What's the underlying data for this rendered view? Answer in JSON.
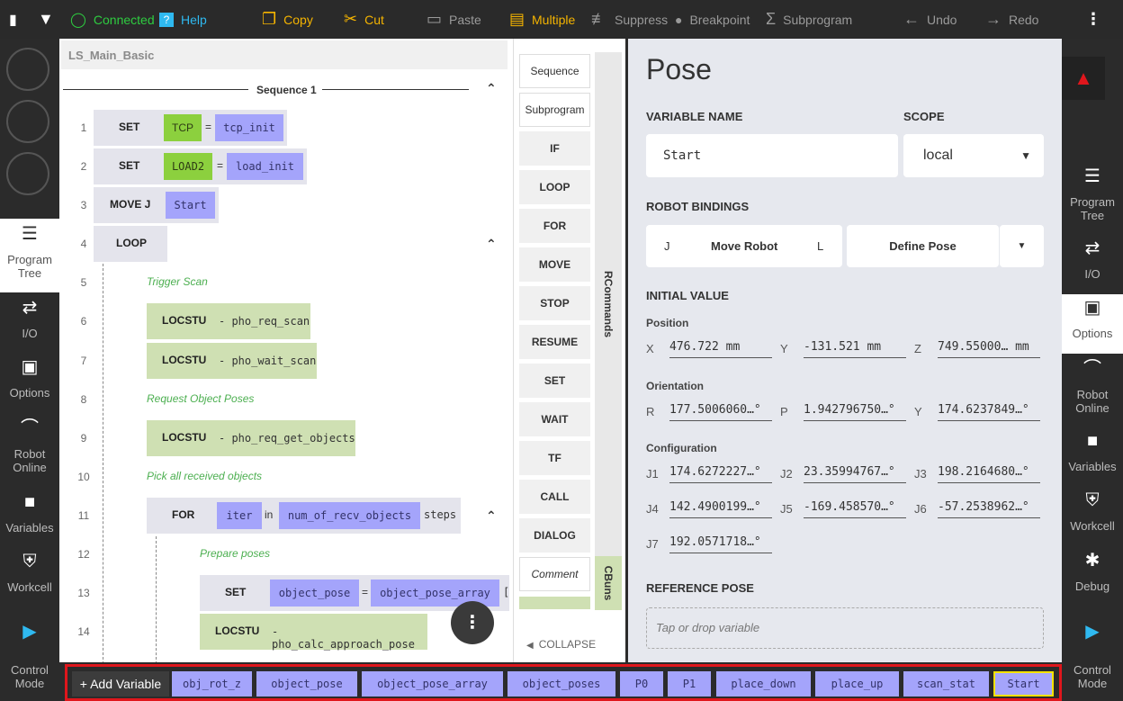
{
  "topbar": {
    "connected": "Connected",
    "help": "Help",
    "copy": "Copy",
    "cut": "Cut",
    "paste": "Paste",
    "multiple": "Multiple",
    "suppress": "Suppress",
    "breakpoint": "Breakpoint",
    "subprogram": "Subprogram",
    "undo": "Undo",
    "redo": "Redo"
  },
  "colors": {
    "accent": "#f5b400",
    "connected": "#2ecc40",
    "help": "#2fb9f0",
    "variable_chip": "#a4a4fb",
    "green_block": "#cfe0b3",
    "highlight_border": "#e0161c"
  },
  "left_rail": {
    "program_tree": "Program Tree",
    "io": "I/O",
    "options": "Options",
    "robot_online": "Robot Online",
    "variables": "Variables",
    "workcell": "Workcell",
    "control_mode": "Control Mode"
  },
  "right_rail": {
    "program_tree": "Program Tree",
    "io": "I/O",
    "options": "Options",
    "robot_online": "Robot Online",
    "variables": "Variables",
    "workcell": "Workcell",
    "debug": "Debug",
    "control_mode": "Control Mode"
  },
  "tree": {
    "program_name": "LS_Main_Basic",
    "sequence_label": "Sequence 1",
    "lines": {
      "n1": "1",
      "n2": "2",
      "n3": "3",
      "n4": "4",
      "n5": "5",
      "n6": "6",
      "n7": "7",
      "n8": "8",
      "n9": "9",
      "n10": "10",
      "n11": "11",
      "n12": "12",
      "n13": "13",
      "n14": "14"
    },
    "l1": {
      "kw": "SET",
      "a": "TCP",
      "eq": "=",
      "b": "tcp_init"
    },
    "l2": {
      "kw": "SET",
      "a": "LOAD2",
      "eq": "=",
      "b": "load_init"
    },
    "l3": {
      "kw": "MOVE J",
      "a": "Start"
    },
    "l4": {
      "kw": "LOOP"
    },
    "l5": {
      "comment": "Trigger Scan"
    },
    "l6": {
      "kw": "LOCSTU",
      "arg": "- pho_req_scan"
    },
    "l7": {
      "kw": "LOCSTU",
      "arg": "- pho_wait_scan"
    },
    "l8": {
      "comment": "Request Object Poses"
    },
    "l9": {
      "kw": "LOCSTU",
      "arg": "- pho_req_get_objects"
    },
    "l10": {
      "comment": "Pick all received objects"
    },
    "l11": {
      "kw": "FOR",
      "a": "iter",
      "in": "in",
      "b": "num_of_recv_objects",
      "steps": "steps"
    },
    "l12": {
      "comment": "Prepare poses"
    },
    "l13": {
      "kw": "SET",
      "a": "object_pose",
      "eq": "=",
      "b": "object_pose_array",
      "tail": "["
    },
    "l14": {
      "kw": "LOCSTU",
      "arg": "- pho_calc_approach_pose"
    }
  },
  "commands": {
    "items": [
      "Sequence",
      "Subprogram",
      "IF",
      "LOOP",
      "FOR",
      "MOVE",
      "STOP",
      "RESUME",
      "SET",
      "WAIT",
      "TF",
      "CALL",
      "DIALOG",
      "Comment"
    ],
    "tab_rcommands": "RCommands",
    "tab_cbuns": "CBuns",
    "collapse": "COLLAPSE"
  },
  "pose": {
    "title": "Pose",
    "variable_name_label": "VARIABLE NAME",
    "variable_name": "Start",
    "scope_label": "SCOPE",
    "scope": "local",
    "robot_bindings_label": "ROBOT BINDINGS",
    "j": "J",
    "move_robot": "Move Robot",
    "l": "L",
    "define_pose": "Define Pose",
    "initial_value_label": "INITIAL VALUE",
    "position_label": "Position",
    "x_label": "X",
    "x": "476.722 mm",
    "y_label": "Y",
    "y": "-131.521 mm",
    "z_label": "Z",
    "z": "749.55000… mm",
    "orientation_label": "Orientation",
    "r_label": "R",
    "r": "177.5006060…°",
    "p_label": "P",
    "p": "1.942796750…°",
    "yaw_label": "Y",
    "yaw": "174.6237849…°",
    "configuration_label": "Configuration",
    "j1_label": "J1",
    "j1": "174.6272227…°",
    "j2_label": "J2",
    "j2": "23.35994767…°",
    "j3_label": "J3",
    "j3": "198.2164680…°",
    "j4_label": "J4",
    "j4": "142.4900199…°",
    "j5_label": "J5",
    "j5": "-169.458570…°",
    "j6_label": "J6",
    "j6": "-57.2538962…°",
    "j7_label": "J7",
    "j7": "192.0571718…°",
    "reference_pose_label": "REFERENCE POSE",
    "reference_placeholder": "Tap or drop variable"
  },
  "variable_bar": {
    "add_variable": "+ Add Variable",
    "vars": [
      "obj_rot_z",
      "object_pose",
      "object_pose_array",
      "object_poses",
      "P0",
      "P1",
      "place_down",
      "place_up",
      "scan_stat",
      "Start"
    ],
    "selected": "Start"
  }
}
